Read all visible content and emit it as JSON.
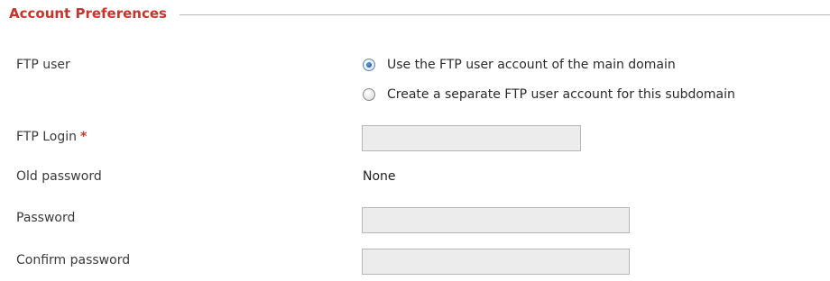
{
  "section": {
    "title": "Account Preferences"
  },
  "ftp_user": {
    "label": "FTP user",
    "options": [
      {
        "label": "Use the FTP user account of the main domain",
        "selected": true
      },
      {
        "label": "Create a separate FTP user account for this subdomain",
        "selected": false
      }
    ]
  },
  "ftp_login": {
    "label": "FTP Login",
    "required_marker": "*",
    "value": ""
  },
  "old_password": {
    "label": "Old password",
    "value": "None"
  },
  "password": {
    "label": "Password",
    "value": ""
  },
  "confirm_password": {
    "label": "Confirm password",
    "value": ""
  },
  "colors": {
    "section_title": "#c8332b",
    "required_marker": "#d0342a",
    "input_background": "#ececec",
    "radio_selected": "#1f5fa8"
  }
}
